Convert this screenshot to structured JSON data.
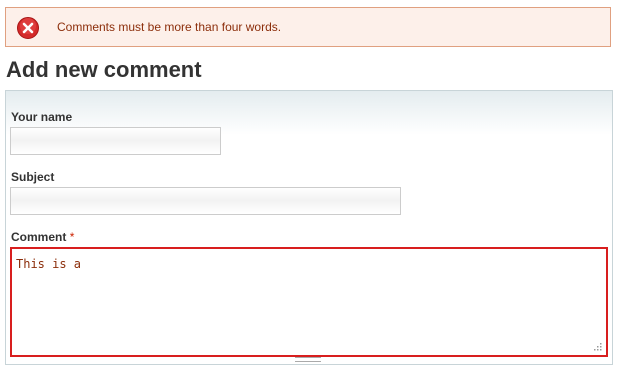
{
  "error": {
    "icon": "error-icon",
    "message": "Comments must be more than four words.",
    "color": "#d42a2a"
  },
  "page": {
    "title": "Add new comment"
  },
  "form": {
    "name_label": "Your name",
    "name_value": "",
    "subject_label": "Subject",
    "subject_value": "",
    "comment_label": "Comment",
    "comment_required_marker": "*",
    "comment_value": "This is a"
  },
  "colors": {
    "error_border": "#d81e1e",
    "error_text": "#8c2e0b",
    "required": "#cc2200"
  }
}
